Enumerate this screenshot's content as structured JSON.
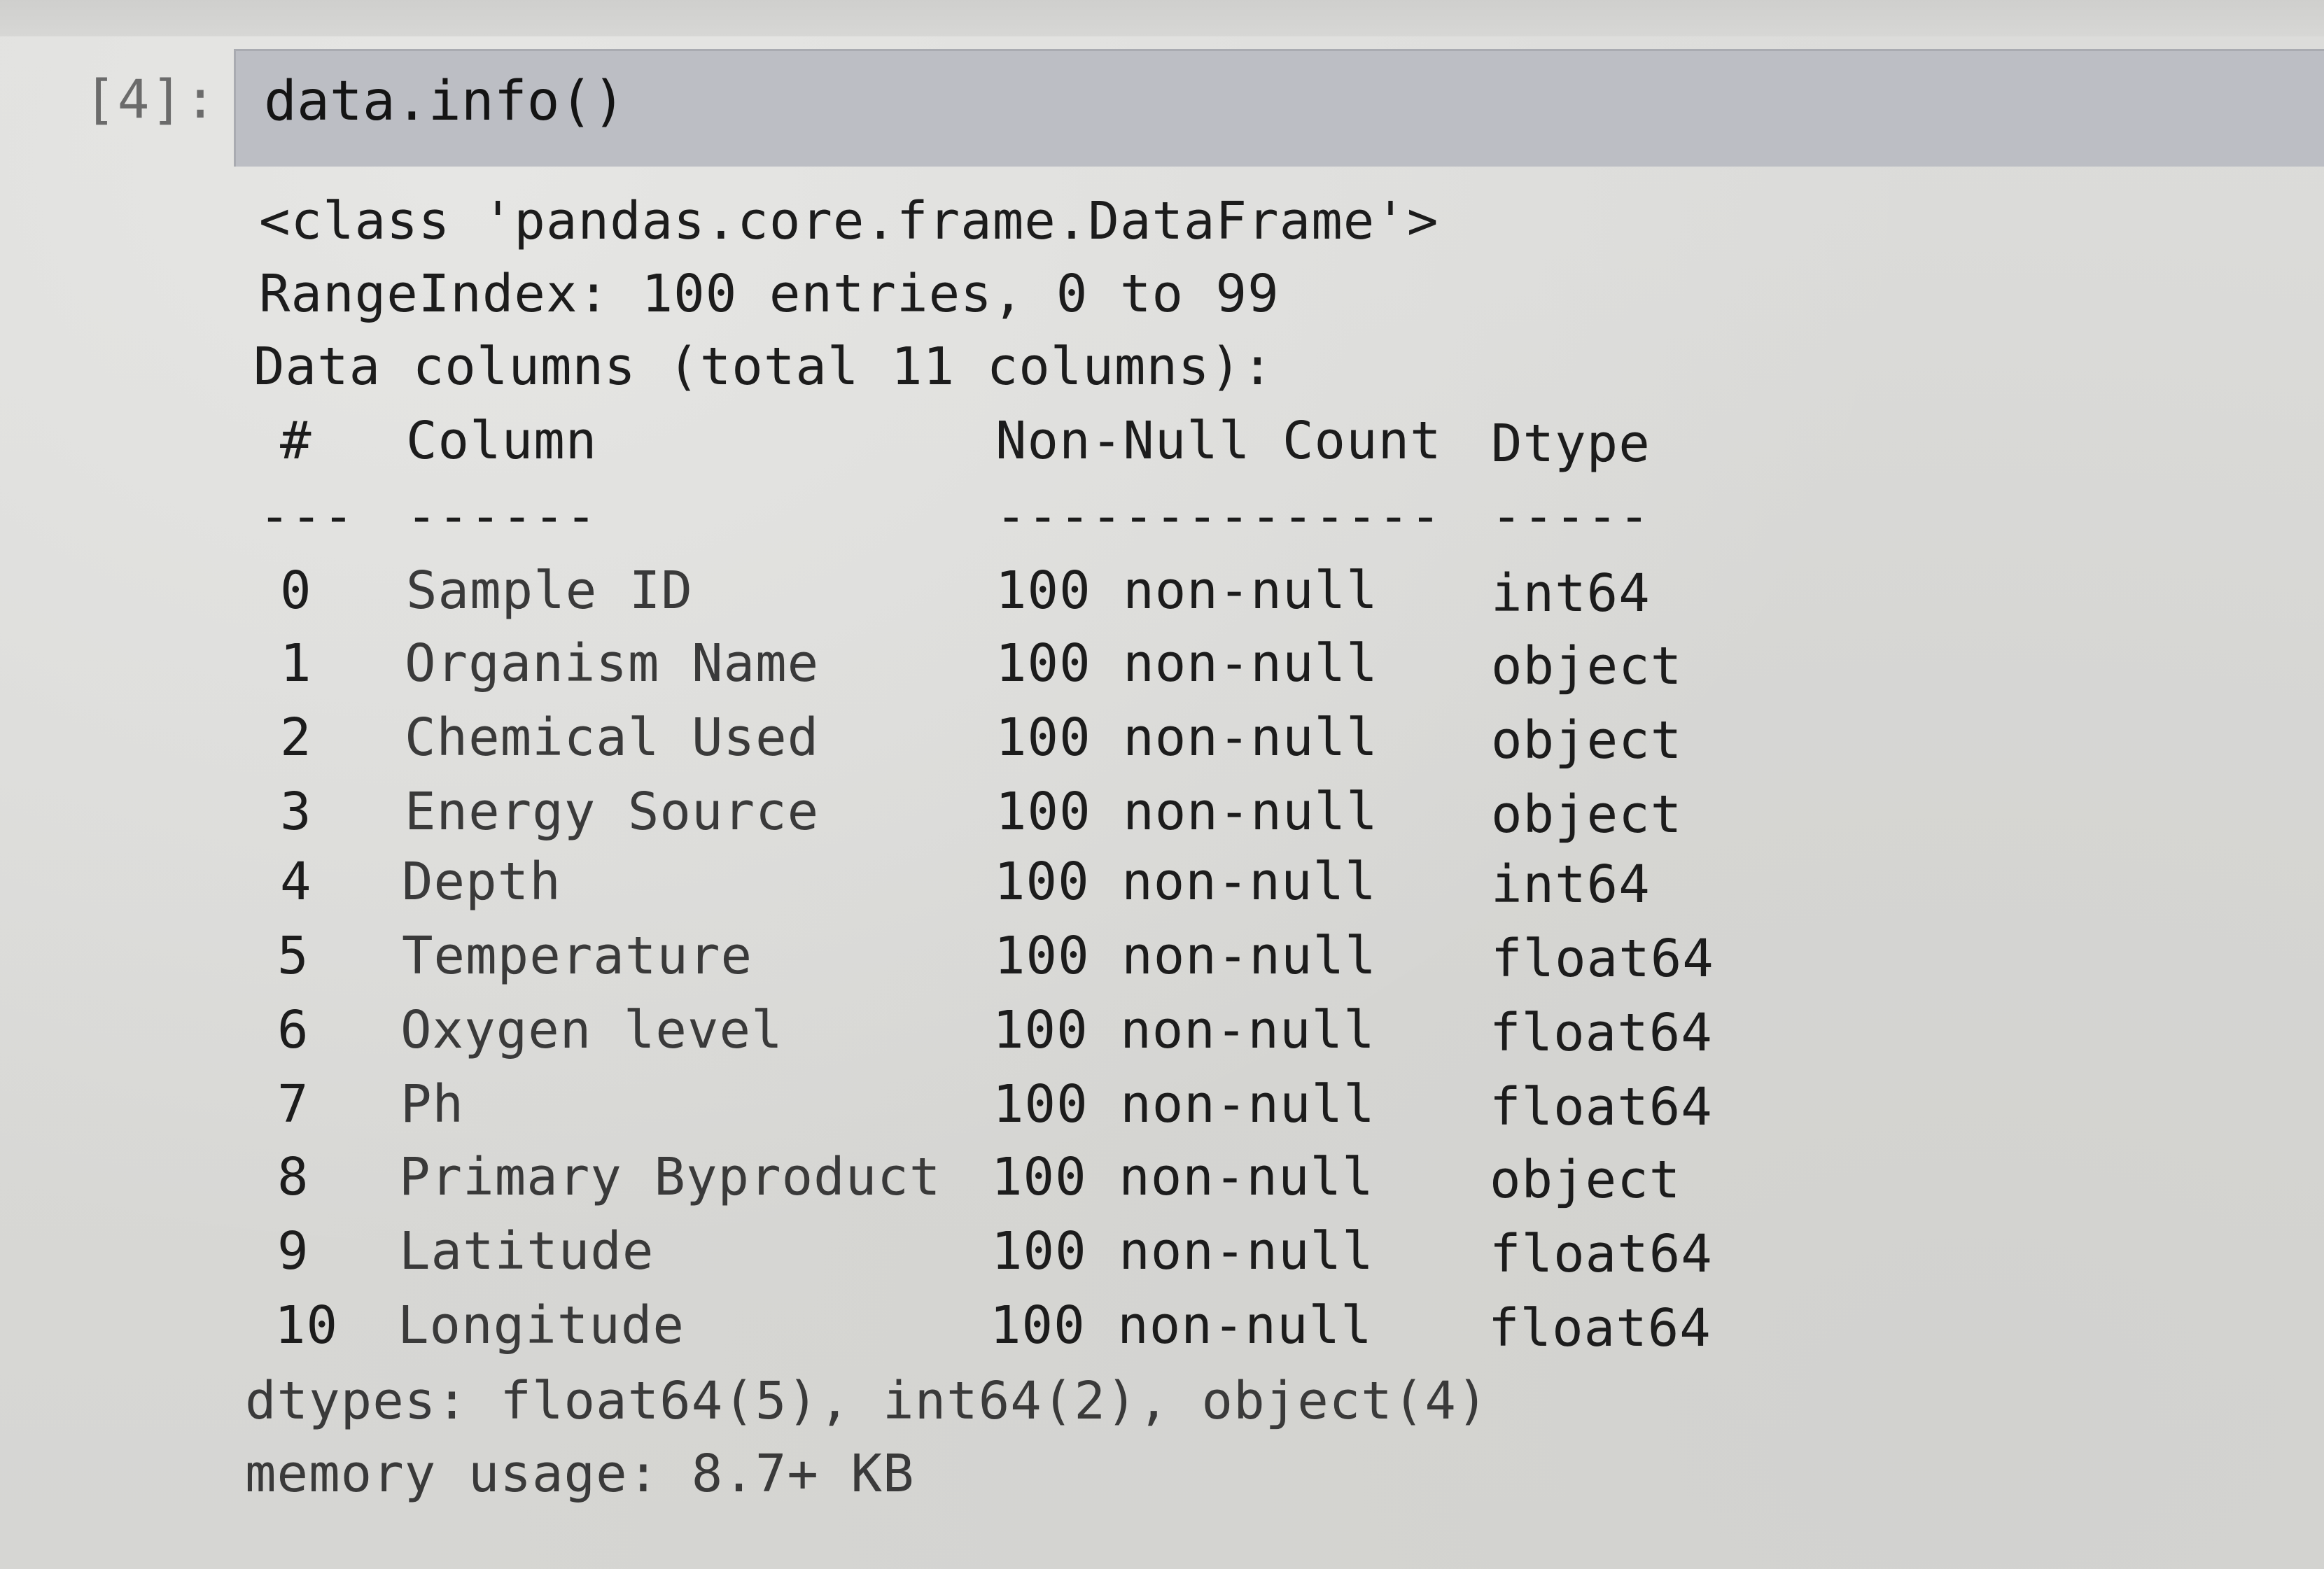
{
  "cell": {
    "prompt": "[4]:",
    "code": "data.info()"
  },
  "output": {
    "class_line": "<class 'pandas.core.frame.DataFrame'>",
    "range_index": "RangeIndex: 100 entries, 0 to 99",
    "data_columns": "Data columns (total 11 columns):",
    "headers": [
      "#",
      "Column",
      "Non-Null Count",
      "Dtype"
    ],
    "separators": [
      "---",
      "------",
      "--------------",
      "-----"
    ],
    "rows": [
      {
        "index": "0",
        "column": "Sample ID",
        "non_null": "100 non-null",
        "dtype": "int64"
      },
      {
        "index": "1",
        "column": "Organism Name",
        "non_null": "100 non-null",
        "dtype": "object"
      },
      {
        "index": "2",
        "column": "Chemical Used",
        "non_null": "100 non-null",
        "dtype": "object"
      },
      {
        "index": "3",
        "column": "Energy Source",
        "non_null": "100 non-null",
        "dtype": "object"
      },
      {
        "index": "4",
        "column": "Depth",
        "non_null": "100 non-null",
        "dtype": "int64"
      },
      {
        "index": "5",
        "column": "Temperature",
        "non_null": "100 non-null",
        "dtype": "float64"
      },
      {
        "index": "6",
        "column": "Oxygen level",
        "non_null": "100 non-null",
        "dtype": "float64"
      },
      {
        "index": "7",
        "column": "Ph",
        "non_null": "100 non-null",
        "dtype": "float64"
      },
      {
        "index": "8",
        "column": "Primary Byproduct",
        "non_null": "100 non-null",
        "dtype": "object"
      },
      {
        "index": "9",
        "column": "Latitude",
        "non_null": "100 non-null",
        "dtype": "float64"
      },
      {
        "index": "10",
        "column": "Longitude",
        "non_null": "100 non-null",
        "dtype": "float64"
      }
    ],
    "dtypes_line": "dtypes: float64(5), int64(2), object(4)",
    "memory_line": "memory usage: 8.7+ KB"
  }
}
